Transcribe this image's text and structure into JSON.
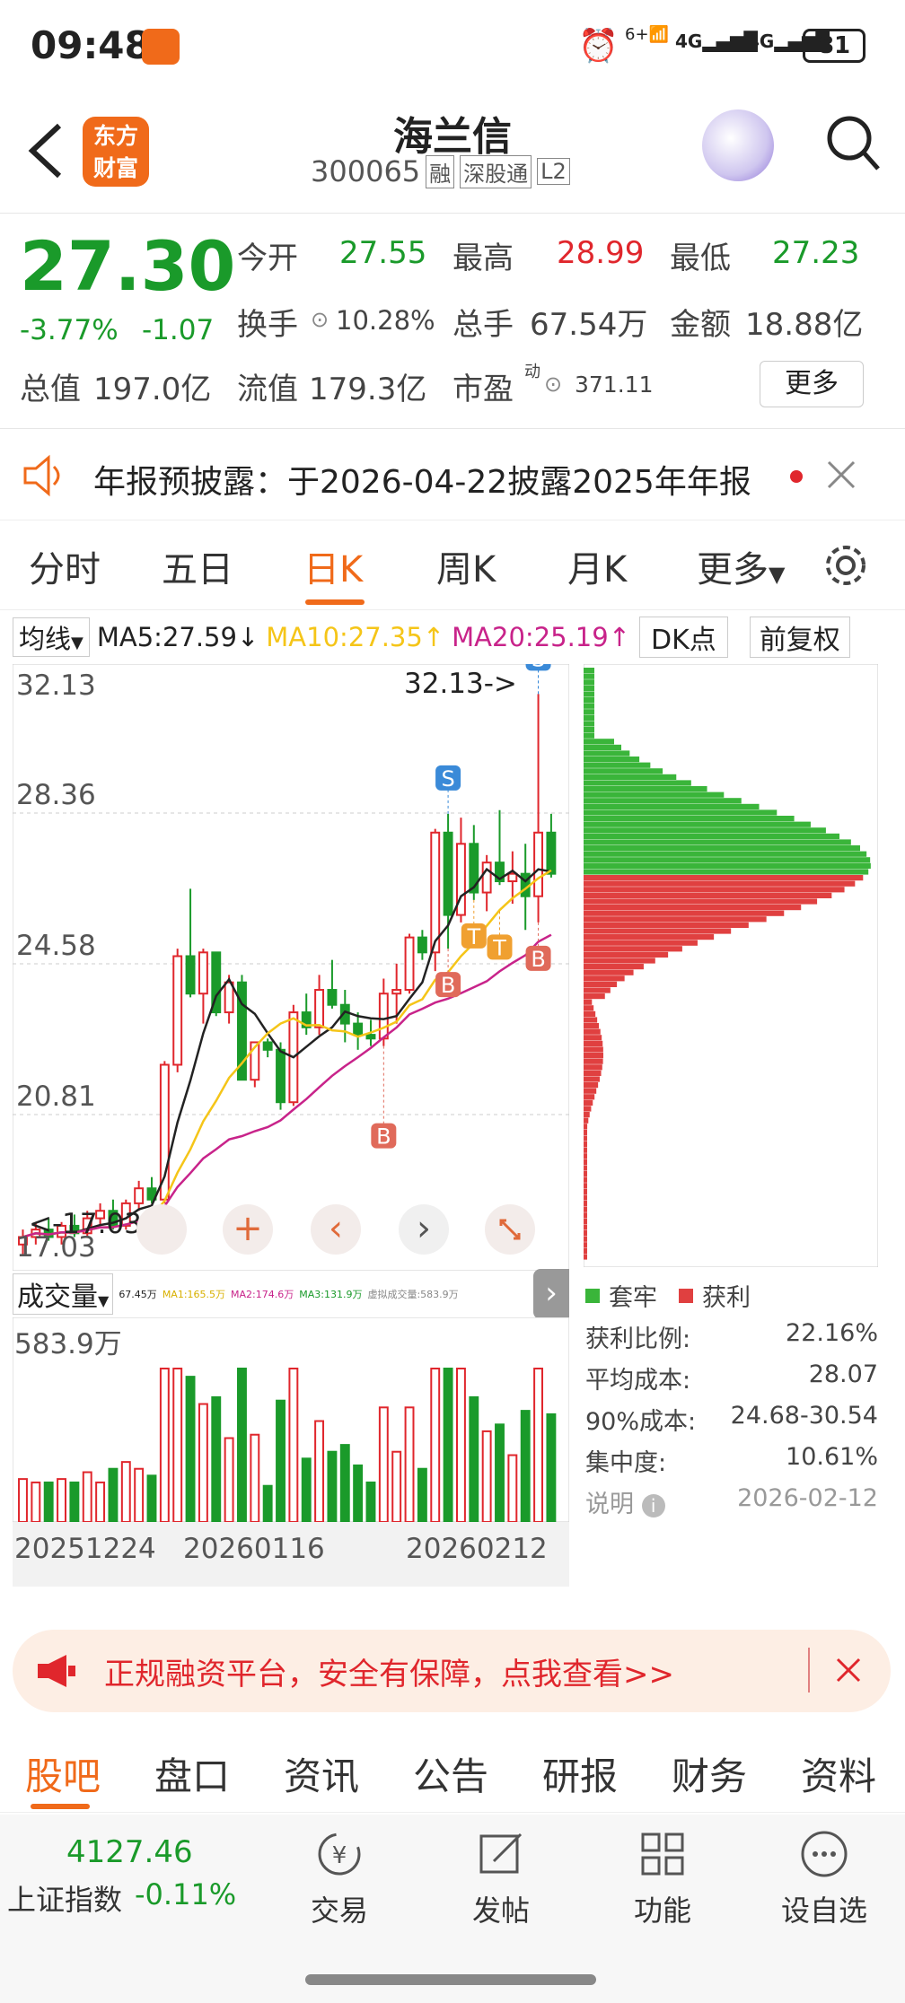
{
  "status": {
    "time": "09:48",
    "battery": "81",
    "net1": "4G",
    "net2": "4G",
    "wifi": "6+"
  },
  "header": {
    "name": "海兰信",
    "code": "300065",
    "badges": [
      "融",
      "深股通",
      "L2"
    ],
    "logo_line1": "东方",
    "logo_line2": "财富"
  },
  "quote": {
    "price": "27.30",
    "pct": "-3.77%",
    "change": "-1.07",
    "open_label": "今开",
    "open": "27.55",
    "high_label": "最高",
    "high": "28.99",
    "low_label": "最低",
    "low": "27.23",
    "turnover_label": "换手",
    "turnover": "10.28%",
    "volume_label": "总手",
    "volume": "67.54万",
    "amount_label": "金额",
    "amount": "18.88亿",
    "mktcap_label": "总值",
    "mktcap": "197.0亿",
    "float_label": "流值",
    "float": "179.3亿",
    "pe_label": "市盈",
    "pe_sup": "动",
    "pe": "371.11",
    "more": "更多"
  },
  "notice": {
    "text": "年报预披露：于2026-04-22披露2025年年报"
  },
  "tabs": [
    "分时",
    "五日",
    "日K",
    "周K",
    "月K",
    "更多"
  ],
  "active_tab": "日K",
  "ma": {
    "label": "均线",
    "ma5": "MA5:27.59",
    "ma10": "MA10:27.35",
    "ma20": "MA20:25.19",
    "dk": "DK点",
    "fq": "前复权"
  },
  "axis": {
    "y1": "32.13",
    "y2": "28.36",
    "y3": "24.58",
    "y4": "20.81",
    "y5": "17.03",
    "max_note": "32.13->",
    "min_note": "<-17.03"
  },
  "volume": {
    "label": "成交量",
    "legend": [
      "67.45万",
      "MA1:165.5万",
      "MA2:174.6万",
      "MA3:131.9万",
      "虚拟成交量:583.9万"
    ],
    "ymax": "583.9万",
    "dates": [
      "20251224",
      "20260116",
      "20260212"
    ]
  },
  "chip": {
    "legend_trap": "套牢",
    "legend_profit": "获利",
    "rows": [
      [
        "获利比例:",
        "22.16%"
      ],
      [
        "平均成本:",
        "28.07"
      ],
      [
        "90%成本:",
        "24.68-30.54"
      ],
      [
        "集中度:",
        "10.61%"
      ],
      [
        "说明",
        "2026-02-12"
      ]
    ]
  },
  "promo": {
    "text": "正规融资平台，安全有保障，点我查看>>"
  },
  "bottom_tabs": [
    "股吧",
    "盘口",
    "资讯",
    "公告",
    "研报",
    "财务",
    "资料"
  ],
  "index": {
    "value": "4127.46",
    "name": "上证指数",
    "pct": "-0.11%"
  },
  "bottom_nav": [
    "交易",
    "发帖",
    "功能",
    "设自选"
  ],
  "colors": {
    "accent": "#f06a1a",
    "up": "#e0262c",
    "down": "#1a9a2a",
    "ma5": "#222222",
    "ma10": "#f5c518",
    "ma20": "#c8238a"
  },
  "chart_data": {
    "type": "candlestick",
    "candles": [
      [
        17.4,
        17.8,
        17.1,
        17.6
      ],
      [
        17.6,
        18.0,
        17.4,
        17.8
      ],
      [
        17.8,
        18.1,
        17.5,
        17.6
      ],
      [
        17.6,
        18.0,
        17.4,
        17.9
      ],
      [
        17.9,
        18.2,
        17.6,
        17.7
      ],
      [
        17.7,
        18.3,
        17.6,
        18.1
      ],
      [
        18.1,
        18.5,
        17.9,
        18.3
      ],
      [
        18.3,
        18.6,
        17.8,
        17.9
      ],
      [
        17.9,
        18.6,
        17.8,
        18.5
      ],
      [
        18.5,
        19.1,
        18.3,
        18.9
      ],
      [
        18.9,
        19.2,
        18.5,
        18.6
      ],
      [
        18.6,
        22.3,
        18.5,
        22.2
      ],
      [
        22.2,
        25.3,
        22.0,
        25.1
      ],
      [
        25.1,
        26.9,
        24.0,
        24.1
      ],
      [
        24.1,
        25.3,
        23.3,
        25.2
      ],
      [
        25.2,
        25.2,
        23.5,
        23.6
      ],
      [
        23.6,
        24.6,
        23.3,
        24.4
      ],
      [
        24.4,
        24.6,
        21.8,
        21.8
      ],
      [
        21.8,
        22.8,
        21.6,
        22.8
      ],
      [
        22.8,
        22.9,
        22.4,
        22.6
      ],
      [
        22.6,
        22.8,
        21.0,
        21.2
      ],
      [
        21.2,
        23.8,
        21.1,
        23.6
      ],
      [
        23.6,
        24.1,
        23.0,
        23.2
      ],
      [
        23.2,
        24.6,
        23.0,
        24.2
      ],
      [
        24.2,
        25.0,
        23.7,
        23.8
      ],
      [
        23.8,
        24.2,
        22.8,
        23.3
      ],
      [
        23.3,
        23.6,
        22.6,
        23.0
      ],
      [
        23.0,
        23.4,
        22.7,
        22.9
      ],
      [
        22.9,
        24.5,
        22.7,
        24.1
      ],
      [
        24.1,
        24.9,
        23.3,
        24.2
      ],
      [
        24.2,
        25.7,
        24.1,
        25.6
      ],
      [
        25.6,
        25.8,
        25.0,
        25.2
      ],
      [
        25.2,
        28.5,
        24.7,
        28.4
      ],
      [
        28.4,
        28.9,
        25.3,
        26.2
      ],
      [
        26.2,
        28.8,
        26.0,
        28.1
      ],
      [
        28.1,
        28.6,
        26.6,
        26.8
      ],
      [
        26.8,
        27.8,
        26.3,
        27.6
      ],
      [
        27.6,
        29.0,
        27.0,
        27.1
      ],
      [
        27.1,
        27.9,
        26.5,
        27.3
      ],
      [
        27.3,
        28.1,
        25.8,
        26.7
      ],
      [
        26.7,
        32.1,
        26.0,
        28.4
      ],
      [
        28.4,
        28.9,
        27.2,
        27.3
      ]
    ],
    "marks": [
      [
        "S",
        33
      ],
      [
        "B",
        33
      ],
      [
        "S",
        40
      ],
      [
        "T",
        35
      ],
      [
        "T",
        36
      ],
      [
        "S",
        40
      ],
      [
        "B",
        40
      ],
      [
        "B",
        28
      ]
    ]
  }
}
